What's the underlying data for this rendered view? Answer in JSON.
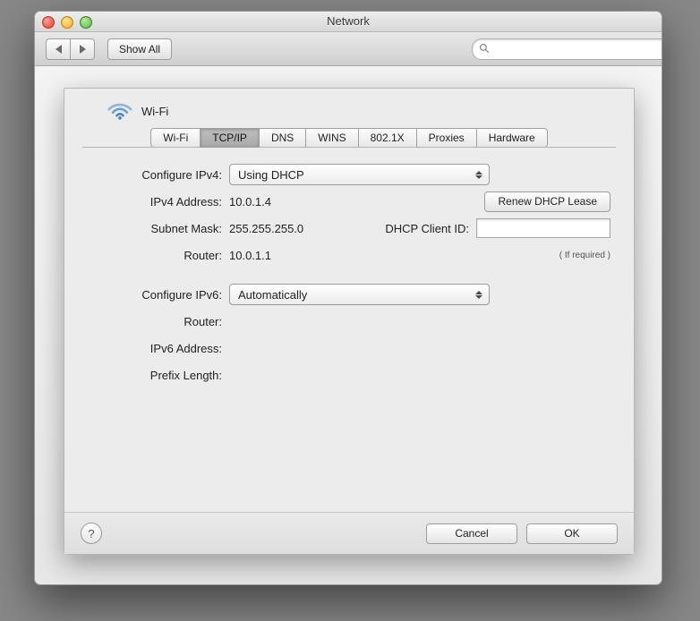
{
  "window": {
    "title": "Network"
  },
  "toolbar": {
    "show_all_label": "Show All",
    "search_placeholder": ""
  },
  "sheet": {
    "interface_name": "Wi-Fi",
    "tabs": [
      "Wi-Fi",
      "TCP/IP",
      "DNS",
      "WINS",
      "802.1X",
      "Proxies",
      "Hardware"
    ],
    "active_tab_index": 1,
    "labels": {
      "configure_ipv4": "Configure IPv4:",
      "ipv4_address": "IPv4 Address:",
      "subnet_mask": "Subnet Mask:",
      "router4": "Router:",
      "configure_ipv6": "Configure IPv6:",
      "router6": "Router:",
      "ipv6_address": "IPv6 Address:",
      "prefix_length": "Prefix Length:",
      "dhcp_client_id": "DHCP Client ID:",
      "if_required": "( If required )"
    },
    "values": {
      "configure_ipv4": "Using DHCP",
      "ipv4_address": "10.0.1.4",
      "subnet_mask": "255.255.255.0",
      "router4": "10.0.1.1",
      "configure_ipv6": "Automatically",
      "router6": "",
      "ipv6_address": "",
      "prefix_length": "",
      "dhcp_client_id": ""
    },
    "buttons": {
      "renew_dhcp": "Renew DHCP Lease",
      "cancel": "Cancel",
      "ok": "OK"
    }
  }
}
